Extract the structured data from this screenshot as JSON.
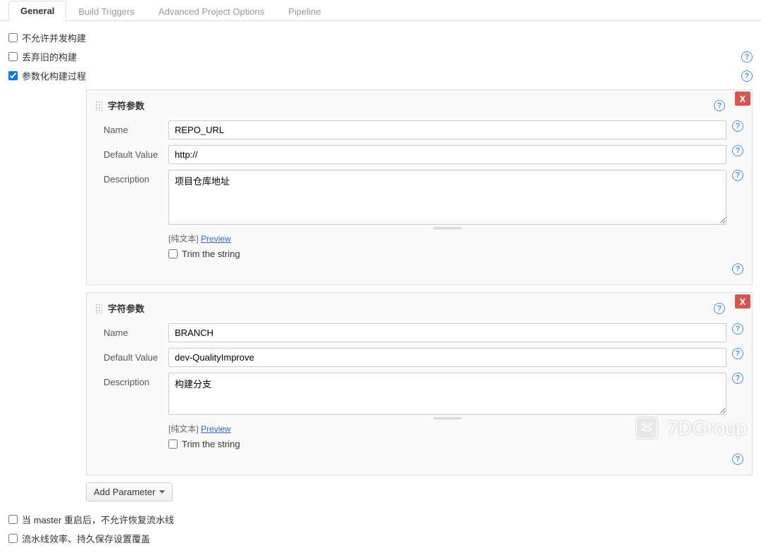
{
  "tabs": [
    {
      "label": "General",
      "active": true
    },
    {
      "label": "Build Triggers"
    },
    {
      "label": "Advanced Project Options"
    },
    {
      "label": "Pipeline"
    }
  ],
  "options": {
    "no_concurrent": {
      "label": "不允许并发构建",
      "checked": false
    },
    "discard_old": {
      "label": "丢弃旧的构建",
      "checked": false
    },
    "parameterized": {
      "label": "参数化构建过程",
      "checked": true
    },
    "master_restart": {
      "label": "当 master 重启后，不允许恢复流水线",
      "checked": false
    },
    "pipeline_eff": {
      "label": "流水线效率、持久保存设置覆盖",
      "checked": false
    }
  },
  "string_param_title": "字符参数",
  "labels": {
    "name": "Name",
    "default_value": "Default Value",
    "description": "Description",
    "plain_text": "[纯文本]",
    "preview": "Preview",
    "trim": "Trim the string",
    "add_param": "Add Parameter"
  },
  "params": [
    {
      "name": "REPO_URL",
      "default_value": "http://",
      "description": "项目仓库地址",
      "desc_height": 78,
      "trim": false
    },
    {
      "name": "BRANCH",
      "default_value": "dev-QualityImprove",
      "description": "构建分支",
      "desc_height": 60,
      "trim": false
    }
  ],
  "watermark": "7DGroup"
}
